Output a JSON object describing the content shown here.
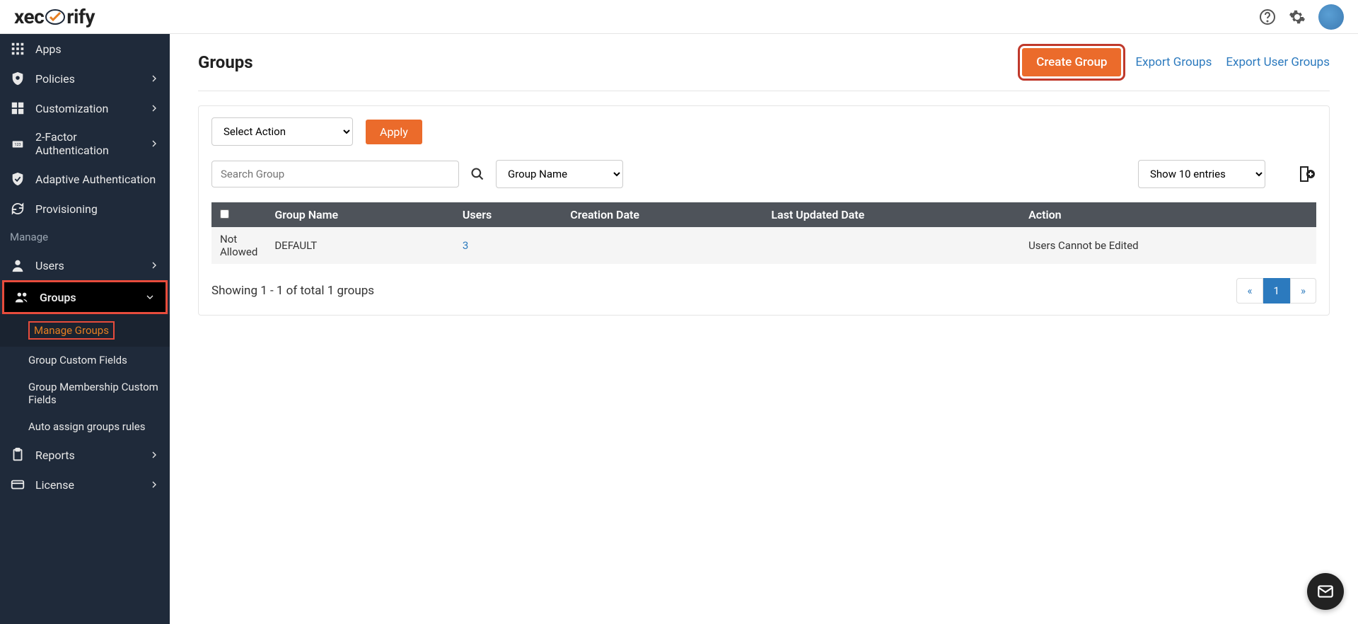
{
  "logo_text1": "xec",
  "logo_text2": "rify",
  "sidebar": {
    "items": [
      {
        "label": "Apps",
        "icon": "apps"
      },
      {
        "label": "Policies",
        "icon": "shield",
        "chevron": true
      },
      {
        "label": "Customization",
        "icon": "widgets",
        "chevron": true
      },
      {
        "label": "2-Factor Authentication",
        "icon": "lock123",
        "chevron": true
      },
      {
        "label": "Adaptive Authentication",
        "icon": "verified"
      },
      {
        "label": "Provisioning",
        "icon": "sync"
      }
    ],
    "section_label": "Manage",
    "manage_items": [
      {
        "label": "Users",
        "icon": "person",
        "chevron": true
      },
      {
        "label": "Groups",
        "icon": "group",
        "chevron": "down",
        "active": true
      }
    ],
    "sub_items": [
      {
        "label": "Manage Groups",
        "active": true
      },
      {
        "label": "Group Custom Fields"
      },
      {
        "label": "Group Membership Custom Fields"
      },
      {
        "label": "Auto assign groups rules"
      }
    ],
    "footer_items": [
      {
        "label": "Reports",
        "icon": "clipboard",
        "chevron": true
      },
      {
        "label": "License",
        "icon": "card",
        "chevron": true
      }
    ]
  },
  "page": {
    "title": "Groups",
    "create_btn": "Create Group",
    "export_groups": "Export Groups",
    "export_user_groups": "Export User Groups"
  },
  "toolbar": {
    "select_action": "Select Action",
    "apply": "Apply",
    "search_placeholder": "Search Group",
    "filter_label": "Group Name",
    "entries_label": "Show 10 entries"
  },
  "table": {
    "headers": [
      "",
      "Group Name",
      "Users",
      "Creation Date",
      "Last Updated Date",
      "Action"
    ],
    "row": {
      "col0": "Not Allowed",
      "col1": "DEFAULT",
      "col2": "3",
      "col3": "",
      "col4": "",
      "col5": "Users Cannot be Edited"
    }
  },
  "footer": {
    "status": "Showing 1 - 1 of total 1 groups",
    "prev": "«",
    "page": "1",
    "next": "»"
  }
}
